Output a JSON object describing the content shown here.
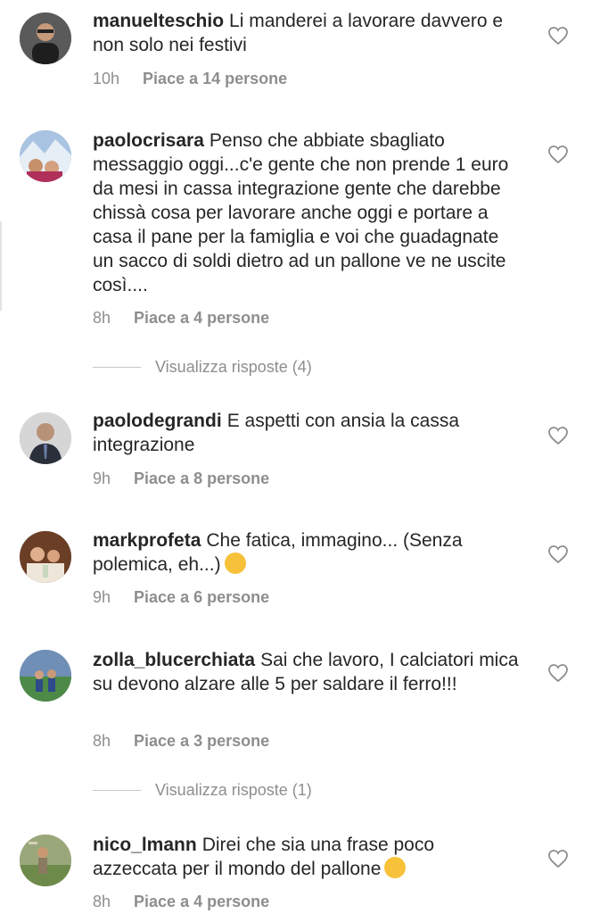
{
  "comments": [
    {
      "username": "manuelteschio",
      "text": "Li manderei a lavorare davvero e non solo nei festivi",
      "time": "10h",
      "likes": "Piace a 14 persone",
      "avatar_color": "#3b3b3b"
    },
    {
      "username": "paolocrisara",
      "text": "Penso che abbiate sbagliato messaggio oggi...c'e gente che non prende 1 euro da mesi in cassa integrazione gente che darebbe chissà cosa per lavorare anche oggi e portare a casa il pane per la famiglia e voi che guadagnate un sacco di soldi dietro ad un pallone ve ne uscite così....",
      "time": "8h",
      "likes": "Piace a 4 persone",
      "avatar_color": "#7a9cc7"
    },
    {
      "username": "paolodegrandi",
      "text": "E aspetti con ansia la cassa integrazione",
      "time": "9h",
      "likes": "Piace a 8 persone",
      "avatar_color": "#b8b8b8"
    },
    {
      "username": "markprofeta",
      "text": "Che fatica, immagino... (Senza polemica, eh...)",
      "emoji": "thinking-face",
      "time": "9h",
      "likes": "Piace a 6 persone",
      "avatar_color": "#8a5a3a"
    },
    {
      "username": "zolla_blucerchiata",
      "text": "Sai che lavoro, I calciatori mica su devono alzare alle 5 per saldare il ferro!!!",
      "time": "8h",
      "likes": "Piace a 3 persone",
      "avatar_color": "#4f7a4a"
    },
    {
      "username": "nico_lmann",
      "text": "Direi che sia una frase poco azzeccata per il mondo del pallone",
      "emoji": "screaming-face",
      "time": "8h",
      "likes": "Piace a 4 persone",
      "avatar_color": "#8c9a6a"
    }
  ],
  "replies": [
    {
      "label": "Visualizza risposte (4)"
    },
    {
      "label": "Visualizza risposte (1)"
    }
  ],
  "colors": {
    "text": "#262626",
    "muted": "#8e8e8e",
    "divider": "#c7c7c7",
    "emoji": "#f7c23a"
  },
  "icons": {
    "like": "heart-outline-icon"
  }
}
